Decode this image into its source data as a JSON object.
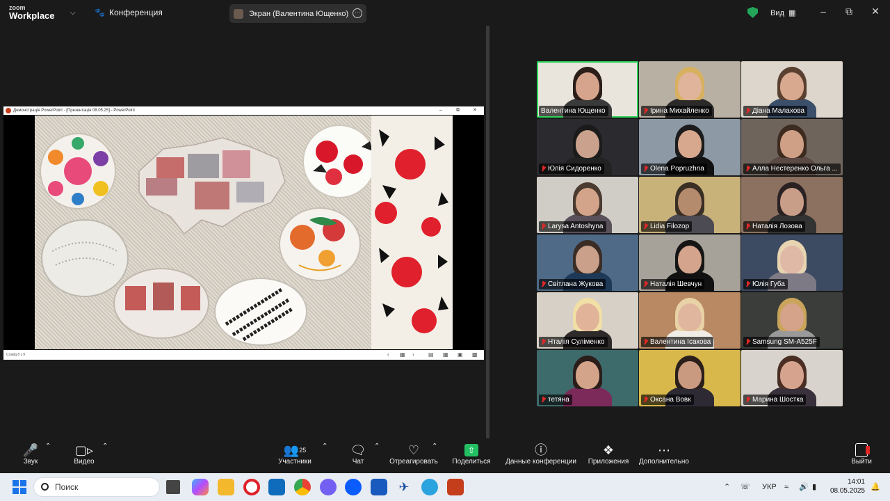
{
  "app": {
    "logo_line1": "zoom",
    "logo_line2": "Workplace",
    "meeting_title": "Конференция",
    "screen_share_label": "Экран (Валентина Ющенко)",
    "view_label": "Вид"
  },
  "presentation": {
    "window_title": "Демонстрація PowerPoint - [Презентація 08.05.25] - PowerPoint",
    "status_text": "Слайд 8 з 9"
  },
  "participants": [
    {
      "name": "Валентина Ющенко",
      "muted": false,
      "active": true,
      "bg": "#e9e4dc",
      "skin": "#d6a48c",
      "hair": "#2b1d18",
      "cloth": "#3a3a3a"
    },
    {
      "name": "Ірина Михайленко",
      "muted": true,
      "active": false,
      "bg": "#b9b0a4",
      "skin": "#e0b49a",
      "hair": "#d8b160",
      "cloth": "#2c2a28"
    },
    {
      "name": "Діана Малахова",
      "muted": true,
      "active": false,
      "bg": "#dcd6cc",
      "skin": "#d8a98e",
      "hair": "#5a4030",
      "cloth": "#3b4f6b"
    },
    {
      "name": "Юлія Сидоренко",
      "muted": true,
      "active": false,
      "bg": "#2b2b2f",
      "skin": "#c9a18c",
      "hair": "#1b1b1b",
      "cloth": "#222"
    },
    {
      "name": "Olena Popruzhna",
      "muted": true,
      "active": false,
      "bg": "#8d9aa6",
      "skin": "#d8a88e",
      "hair": "#1c1c1c",
      "cloth": "#111"
    },
    {
      "name": "Алла Нестеренко Ольга ...",
      "muted": true,
      "active": false,
      "bg": "#6e645c",
      "skin": "#cfa086",
      "hair": "#3e2b20",
      "cloth": "#5b4a44"
    },
    {
      "name": "Larysa Antoshyna",
      "muted": true,
      "active": false,
      "bg": "#cfcdc6",
      "skin": "#d3a489",
      "hair": "#4a3a30",
      "cloth": "#59505a"
    },
    {
      "name": "Lidia Filozop",
      "muted": true,
      "active": false,
      "bg": "#c9b27a",
      "skin": "#b58b6e",
      "hair": "#3a2f25",
      "cloth": "#4c4a52"
    },
    {
      "name": "Наталія Лозова",
      "muted": true,
      "active": false,
      "bg": "#8c7060",
      "skin": "#c89e88",
      "hair": "#2a2222",
      "cloth": "#333"
    },
    {
      "name": "Світлана Жукова",
      "muted": true,
      "active": false,
      "bg": "#4e6a86",
      "skin": "#caa08a",
      "hair": "#3b2d25",
      "cloth": "#1e3857"
    },
    {
      "name": "Наталія Шевчун",
      "muted": true,
      "active": false,
      "bg": "#a6a199",
      "skin": "#d4a58c",
      "hair": "#151515",
      "cloth": "#111"
    },
    {
      "name": "Юлія Губа",
      "muted": true,
      "active": false,
      "bg": "#3c4a62",
      "skin": "#e0b9a6",
      "hair": "#e7d4b0",
      "cloth": "#7d7a86"
    },
    {
      "name": "Нталія Суліменко",
      "muted": true,
      "active": false,
      "bg": "#d6d0c6",
      "skin": "#e1b49a",
      "hair": "#f1dfa6",
      "cloth": "#2f2a2a"
    },
    {
      "name": "Валентина Ісакова",
      "muted": true,
      "active": false,
      "bg": "#b88962",
      "skin": "#e0b79e",
      "hair": "#e8d2a6",
      "cloth": "#f0ece6"
    },
    {
      "name": "Samsung SM-A525F",
      "muted": true,
      "active": false,
      "bg": "#3a3d3a",
      "skin": "#d4a38a",
      "hair": "#c9a45a",
      "cloth": "#9a9a9a"
    },
    {
      "name": "тетяна",
      "muted": true,
      "active": false,
      "bg": "#3d6a6a",
      "skin": "#d3a48a",
      "hair": "#2a1d1a",
      "cloth": "#7c2a5a"
    },
    {
      "name": "Оксана Вовк",
      "muted": true,
      "active": false,
      "bg": "#d8b84a",
      "skin": "#c99a80",
      "hair": "#2b1f1b",
      "cloth": "#2d2a34"
    },
    {
      "name": "Марина Шостка",
      "muted": true,
      "active": false,
      "bg": "#d9d3cd",
      "skin": "#d6a48e",
      "hair": "#4a2e24",
      "cloth": "#38303a"
    }
  ],
  "toolbar": {
    "audio_label": "Звук",
    "video_label": "Видео",
    "participants_label": "Участники",
    "participants_count": "25",
    "chat_label": "Чат",
    "react_label": "Отреагировать",
    "share_label": "Поделиться",
    "info_label": "Данные конференции",
    "apps_label": "Приложения",
    "more_label": "Дополнительно",
    "leave_label": "Выйти"
  },
  "taskbar": {
    "search_placeholder": "Поиск",
    "language": "УКР",
    "time": "14:01",
    "date": "08.05.2025"
  },
  "colors": {
    "active_speaker": "#2dd35a",
    "share_green": "#23c063",
    "muted_red": "#e02828"
  }
}
